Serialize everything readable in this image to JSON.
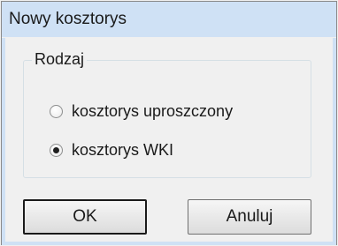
{
  "window": {
    "title": "Nowy kosztorys"
  },
  "group": {
    "label": "Rodzaj",
    "options": [
      {
        "label": "kosztorys uproszczony",
        "selected": false
      },
      {
        "label": "kosztorys WKI",
        "selected": true
      }
    ]
  },
  "buttons": {
    "ok_label": "OK",
    "cancel_label": "Anuluj"
  },
  "colors": {
    "titlebar": "#cfe1f5",
    "client": "#f0f0f0"
  }
}
